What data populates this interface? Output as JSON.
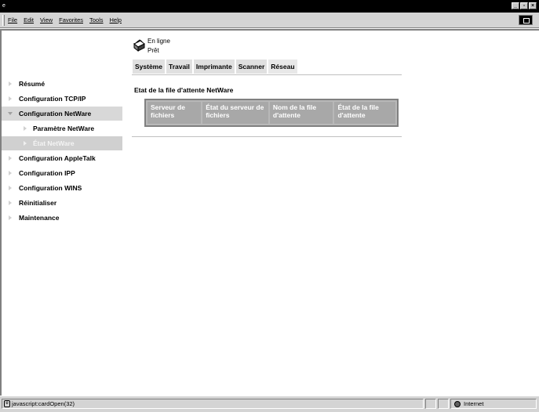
{
  "window": {
    "system_icon": "e"
  },
  "menu": {
    "items": [
      "File",
      "Edit",
      "View",
      "Favorites",
      "Tools",
      "Help"
    ]
  },
  "status": {
    "line1": "En ligne",
    "line2": "Prêt",
    "icon": "printer-icon"
  },
  "tabs": [
    {
      "label": "Système"
    },
    {
      "label": "Travail"
    },
    {
      "label": "Imprimante"
    },
    {
      "label": "Scanner"
    },
    {
      "label": "Réseau"
    }
  ],
  "sidebar": {
    "items": [
      {
        "label": "Résumé"
      },
      {
        "label": "Configuration TCP/IP"
      },
      {
        "label": "Configuration NetWare"
      },
      {
        "label": "Paramètre NetWare"
      },
      {
        "label": "État NetWare"
      },
      {
        "label": "Configuration AppleTalk"
      },
      {
        "label": "Configuration IPP"
      },
      {
        "label": "Configuration WINS"
      },
      {
        "label": "Réinitialiser"
      },
      {
        "label": "Maintenance"
      }
    ]
  },
  "main": {
    "title": "Etat de la file d'attente NetWare",
    "table": {
      "headers": [
        "Serveur de fichiers",
        "État du serveur de fichiers",
        "Nom de la file d'attente",
        "État de la file d'attente"
      ]
    }
  },
  "statusbar": {
    "text": "javascript:cardOpen(32)",
    "zone": "Internet"
  },
  "colors": {
    "table_header_bg": "#a8a8a8",
    "selected_nav_bg": "#d0d0d0",
    "titlebar": "#000000"
  }
}
